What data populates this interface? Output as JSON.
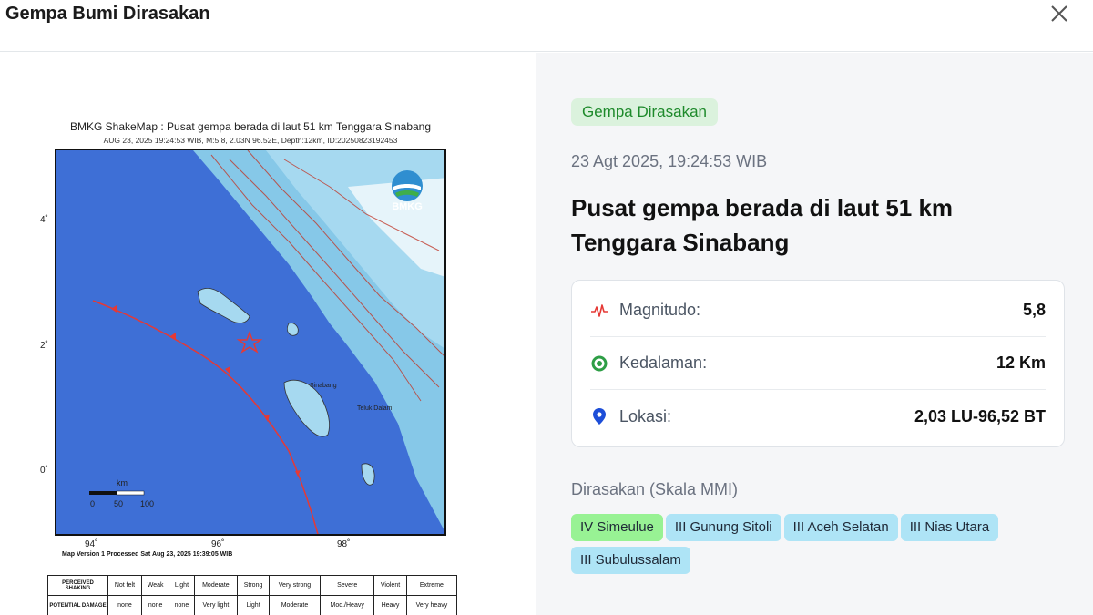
{
  "dialog": {
    "title": "Gempa Bumi Dirasakan",
    "close_icon": "close-icon"
  },
  "shakemap": {
    "title": "BMKG ShakeMap : Pusat gempa berada di laut 51 km Tenggara Sinabang",
    "subtitle": "AUG 23, 2025 19:24:53 WIB, M:5.8, 2.03N 96.52E, Depth:12km, ID:20250823192453",
    "logo_text": "BMKG",
    "lat_ticks": [
      "4˚",
      "2˚",
      "0˚"
    ],
    "lon_ticks": [
      "94˚",
      "96˚",
      "98˚"
    ],
    "scale_unit": "km",
    "scale_ticks": [
      "0",
      "50",
      "100"
    ],
    "version_text": "Map Version 1 Processed Sat Aug 23, 2025 19:39:05 WIB",
    "place_labels": [
      "Sinabang",
      "Teluk Dalam"
    ],
    "legend": {
      "row1_header": "PERCEIVED SHAKING",
      "row1": [
        "Not felt",
        "Weak",
        "Light",
        "Moderate",
        "Strong",
        "Very strong",
        "Severe",
        "Violent",
        "Extreme"
      ],
      "row2_header": "POTENTIAL DAMAGE",
      "row2": [
        "none",
        "none",
        "none",
        "Very light",
        "Light",
        "Moderate",
        "Mod./Heavy",
        "Heavy",
        "Very heavy"
      ]
    }
  },
  "event": {
    "status_badge": "Gempa Dirasakan",
    "timestamp": "23 Agt 2025, 19:24:53 WIB",
    "headline": "Pusat gempa berada di laut 51 km Tenggara Sinabang",
    "magnitude_label": "Magnitudo:",
    "magnitude_value": "5,8",
    "depth_label": "Kedalaman:",
    "depth_value": "12 Km",
    "location_label": "Lokasi:",
    "location_value": "2,03 LU-96,52 BT"
  },
  "felt": {
    "label": "Dirasakan (Skala MMI)",
    "chips": [
      {
        "text": "IV Simeulue",
        "level": "IV"
      },
      {
        "text": "III Gunung Sitoli",
        "level": "III"
      },
      {
        "text": "III Aceh Selatan",
        "level": "III"
      },
      {
        "text": "III Nias Utara",
        "level": "III"
      },
      {
        "text": "III Subulussalam",
        "level": "III"
      }
    ]
  },
  "colors": {
    "green_badge_bg": "#dbf2dd",
    "green_badge_text": "#1e8a2b",
    "chip_iv": "#98f294",
    "chip_iii": "#aee4f6",
    "sea": "#3e6fd6",
    "epicenter": "#e53935"
  }
}
